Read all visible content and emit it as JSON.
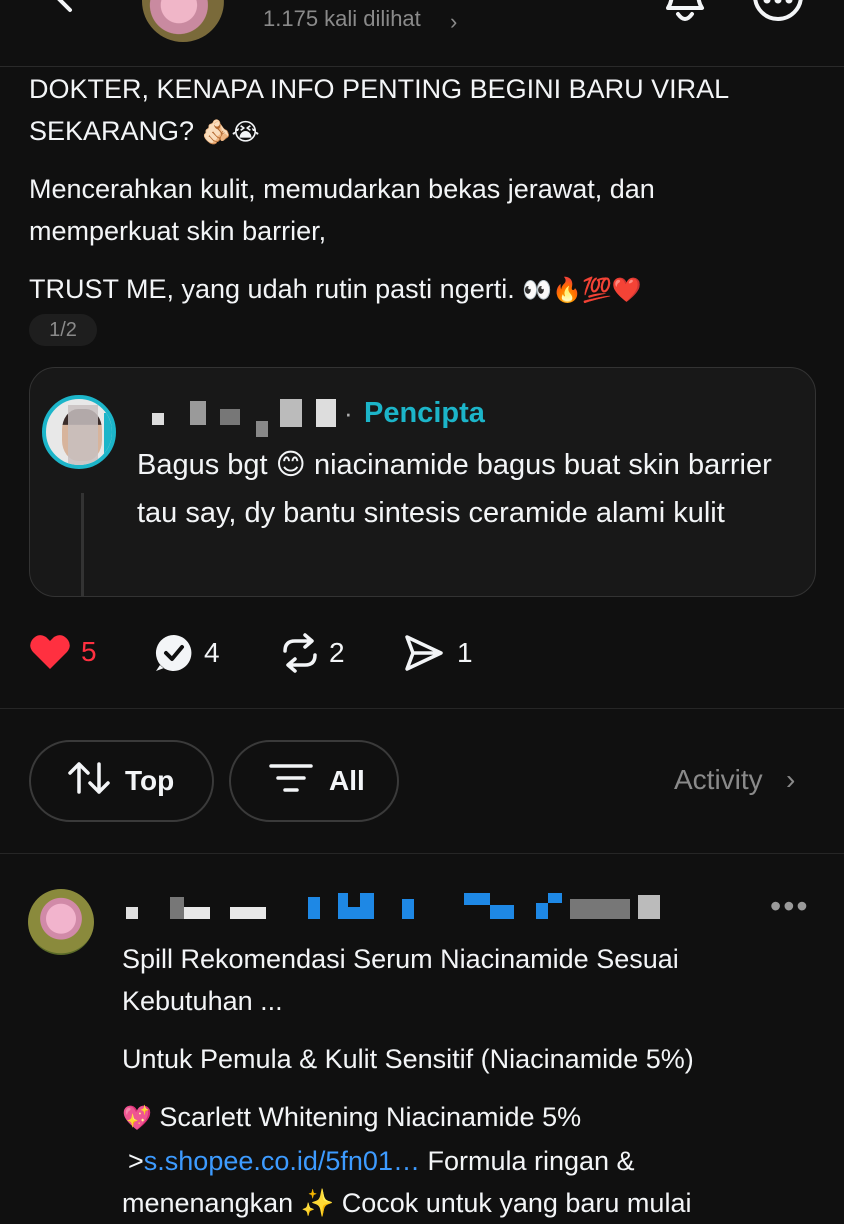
{
  "header": {
    "views": "1.175 kali dilihat",
    "views_chevron": "›"
  },
  "post": {
    "line1": "DOKTER, KENAPA INFO PENTING BEGINI BARU VIRAL",
    "line2": "SEKARANG?",
    "line2_emoji": "🫵🏻😭",
    "para2": "Mencerahkan kulit, memudarkan bekas jerawat, dan memperkuat skin barrier,",
    "para3": "TRUST ME, yang udah rutin pasti ngerti.",
    "para3_emoji": "👀🔥💯❤️",
    "pager": "1/2"
  },
  "reply": {
    "dot": "·",
    "role": "Pencipta",
    "text": "Bagus bgt 😊 niacinamide bagus buat skin barrier tau say, dy bantu sintesis ceramide alami kulit"
  },
  "actions": {
    "likes": "5",
    "comments": "4",
    "reposts": "2",
    "shares": "1",
    "like_color": "#ff3040",
    "accent": "#1cb5c9"
  },
  "filters": {
    "sort_label": "Top",
    "filter_label": "All",
    "activity_label": "Activity",
    "activity_chevron": "›"
  },
  "comment": {
    "more": "•••",
    "line1": "Spill Rekomendasi Serum Niacinamide Sesuai",
    "line2": "Kebutuhan ...",
    "line3": "Untuk Pemula & Kulit Sensitif (Niacinamide 5%)",
    "line4_emoji": "💖",
    "line4": "Scarlett Whitening Niacinamide 5%",
    "line5_prefix": ">",
    "line5_link": "s.shopee.co.id/5fn01…",
    "line5_rest": " Formula ringan &",
    "line6": "menenangkan ✨ Cocok untuk yang baru mulai",
    "link_color": "#3d9bff"
  }
}
